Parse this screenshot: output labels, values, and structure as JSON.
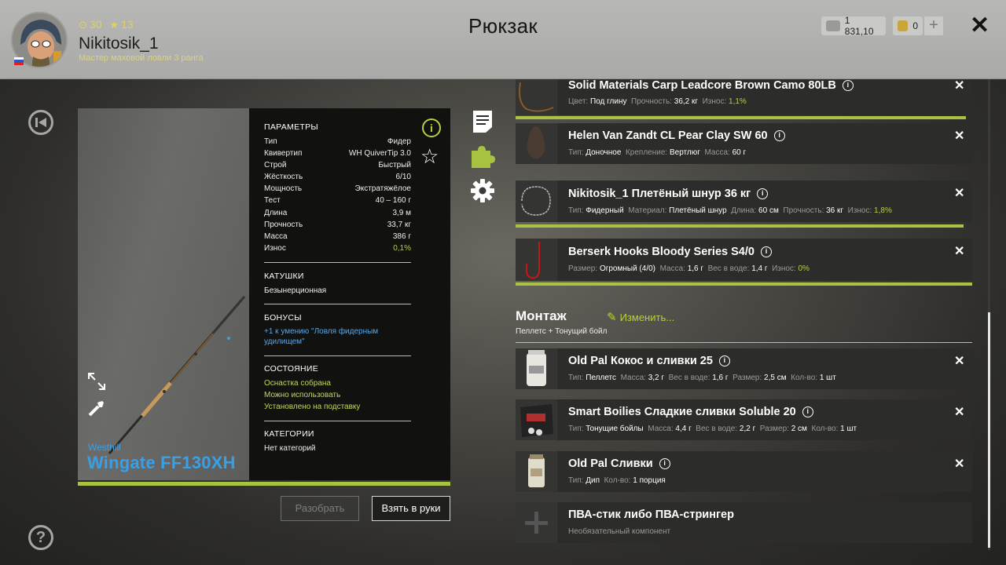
{
  "header": {
    "title": "Рюкзак",
    "username": "Nikitosik_1",
    "rank": "Мастер маховой ловли 3 ранга",
    "level": "30",
    "stars": "13",
    "silver": "1 831,10",
    "gold": "0",
    "plus": "+",
    "close": "✕"
  },
  "rod": {
    "brand": "Westhill",
    "name": "Wingate FF130XH"
  },
  "params": {
    "title": "ПАРАМЕТРЫ",
    "rows": [
      {
        "k": "Тип",
        "v": "Фидер"
      },
      {
        "k": "Квивертип",
        "v": "WH QuiverTip 3.0"
      },
      {
        "k": "Строй",
        "v": "Быстрый"
      },
      {
        "k": "Жёсткость",
        "v": "6/10"
      },
      {
        "k": "Мощность",
        "v": "Экстратяжёлое"
      },
      {
        "k": "Тест",
        "v": "40 – 160 г"
      },
      {
        "k": "Длина",
        "v": "3,9 м"
      },
      {
        "k": "Прочность",
        "v": "33,7 кг"
      },
      {
        "k": "Масса",
        "v": "386 г"
      },
      {
        "k": "Износ",
        "v": "0,1%"
      }
    ],
    "reels_title": "КАТУШКИ",
    "reels_value": "Безынерционная",
    "bonus_title": "БОНУСЫ",
    "bonus_value": "+1 к умению \"Ловля фидерным удилищем\"",
    "state_title": "СОСТОЯНИЕ",
    "state": [
      "Оснастка собрана",
      "Можно использовать",
      "Установлено на подставку"
    ],
    "cat_title": "КАТЕГОРИИ",
    "cat_value": "Нет категорий"
  },
  "buttons": {
    "disassemble": "Разобрать",
    "take": "Взять в руки"
  },
  "items": [
    {
      "name": "Solid Materials Carp Leadcore Brown Camo 80LB",
      "props": [
        [
          "Цвет:",
          "Под глину"
        ],
        [
          "Прочность:",
          "36,2 кг"
        ],
        [
          "Износ:",
          "1,1%"
        ]
      ]
    },
    {
      "name": "Helen Van Zandt CL Pear Clay SW 60",
      "props": [
        [
          "Тип:",
          "Доночное"
        ],
        [
          "Крепление:",
          "Вертлюг"
        ],
        [
          "Масса:",
          "60 г"
        ]
      ]
    },
    {
      "name": "Nikitosik_1 Плетёный шнур 36 кг",
      "props": [
        [
          "Тип:",
          "Фидерный"
        ],
        [
          "Материал:",
          "Плетёный шнур"
        ],
        [
          "Длина:",
          "60 см"
        ],
        [
          "Прочность:",
          "36 кг"
        ],
        [
          "Износ:",
          "1,8%"
        ]
      ]
    },
    {
      "name": "Berserk Hooks Bloody Series S4/0",
      "props": [
        [
          "Размер:",
          "Огромный (4/0)"
        ],
        [
          "Масса:",
          "1,6 г"
        ],
        [
          "Вес в воде:",
          "1,4 г"
        ],
        [
          "Износ:",
          "0%"
        ]
      ]
    }
  ],
  "montage": {
    "title": "Монтаж",
    "edit": "Изменить...",
    "subtitle": "Пеллетс  +  Тонущий бойл"
  },
  "baits": [
    {
      "name": "Old Pal Кокос и сливки 25",
      "props": [
        [
          "Тип:",
          "Пеллетс"
        ],
        [
          "Масса:",
          "3,2 г"
        ],
        [
          "Вес в воде:",
          "1,6 г"
        ],
        [
          "Размер:",
          "2,5 см"
        ],
        [
          "Кол-во:",
          "1 шт"
        ]
      ]
    },
    {
      "name": "Smart Boilies Сладкие сливки Soluble 20",
      "props": [
        [
          "Тип:",
          "Тонущие бойлы"
        ],
        [
          "Масса:",
          "4,4 г"
        ],
        [
          "Вес в воде:",
          "2,2 г"
        ],
        [
          "Размер:",
          "2 см"
        ],
        [
          "Кол-во:",
          "1 шт"
        ]
      ]
    },
    {
      "name": "Old Pal Сливки",
      "props": [
        [
          "Тип:",
          "Дип"
        ],
        [
          "Кол-во:",
          "1 порция"
        ]
      ]
    },
    {
      "name": "ПВА-стик либо ПВА-стрингер",
      "props": [
        [
          "Необязательный компонент",
          ""
        ]
      ]
    }
  ],
  "colors": {
    "accent": "#a8c241",
    "brand_blue": "#3aa0e6"
  }
}
